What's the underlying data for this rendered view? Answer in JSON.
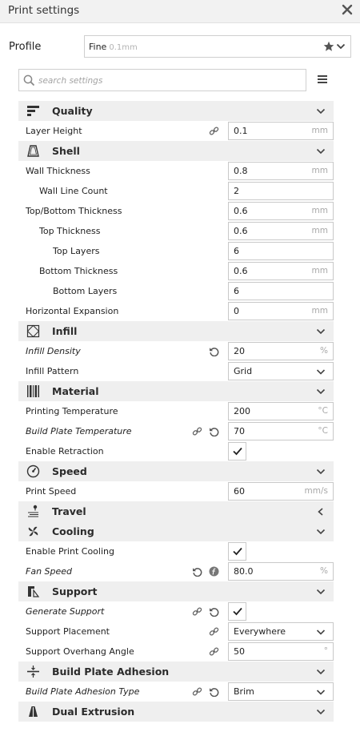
{
  "window": {
    "title": "Print settings"
  },
  "profile": {
    "label": "Profile",
    "name": "Fine",
    "detail": "0.1mm"
  },
  "search": {
    "placeholder": "search settings"
  },
  "colors": {
    "category_bg": "#efefef",
    "field_border": "#c9c9c9",
    "unit_text": "#a8a8a8"
  },
  "rows": [
    {
      "type": "cat",
      "label": "Quality",
      "icon": "quality-icon",
      "expanded": true
    },
    {
      "type": "setting",
      "label": "Layer Height",
      "indent": 0,
      "value": "0.1",
      "unit": "mm",
      "indicators": [
        "link"
      ]
    },
    {
      "type": "cat",
      "label": "Shell",
      "icon": "shell-icon",
      "expanded": true
    },
    {
      "type": "setting",
      "label": "Wall Thickness",
      "indent": 0,
      "value": "0.8",
      "unit": "mm"
    },
    {
      "type": "setting",
      "label": "Wall Line Count",
      "indent": 1,
      "value": "2",
      "unit": ""
    },
    {
      "type": "setting",
      "label": "Top/Bottom Thickness",
      "indent": 0,
      "value": "0.6",
      "unit": "mm"
    },
    {
      "type": "setting",
      "label": "Top Thickness",
      "indent": 1,
      "value": "0.6",
      "unit": "mm"
    },
    {
      "type": "setting",
      "label": "Top Layers",
      "indent": 2,
      "value": "6",
      "unit": ""
    },
    {
      "type": "setting",
      "label": "Bottom Thickness",
      "indent": 1,
      "value": "0.6",
      "unit": "mm"
    },
    {
      "type": "setting",
      "label": "Bottom Layers",
      "indent": 2,
      "value": "6",
      "unit": ""
    },
    {
      "type": "setting",
      "label": "Horizontal Expansion",
      "indent": 0,
      "value": "0",
      "unit": "mm"
    },
    {
      "type": "cat",
      "label": "Infill",
      "icon": "infill-icon",
      "expanded": true
    },
    {
      "type": "setting",
      "label": "Infill Density",
      "indent": 0,
      "italic": true,
      "value": "20",
      "unit": "%",
      "indicators": [
        "reset"
      ]
    },
    {
      "type": "select",
      "label": "Infill Pattern",
      "indent": 0,
      "value": "Grid"
    },
    {
      "type": "cat",
      "label": "Material",
      "icon": "material-icon",
      "expanded": true
    },
    {
      "type": "setting",
      "label": "Printing Temperature",
      "indent": 0,
      "value": "200",
      "unit": "°C"
    },
    {
      "type": "setting",
      "label": "Build Plate Temperature",
      "indent": 0,
      "italic": true,
      "value": "70",
      "unit": "°C",
      "indicators": [
        "link",
        "reset"
      ]
    },
    {
      "type": "check",
      "label": "Enable Retraction",
      "indent": 0,
      "checked": true
    },
    {
      "type": "cat",
      "label": "Speed",
      "icon": "speed-icon",
      "expanded": true
    },
    {
      "type": "setting",
      "label": "Print Speed",
      "indent": 0,
      "value": "60",
      "unit": "mm/s"
    },
    {
      "type": "cat",
      "label": "Travel",
      "icon": "travel-icon",
      "expanded": false
    },
    {
      "type": "cat",
      "label": "Cooling",
      "icon": "cooling-icon",
      "expanded": true
    },
    {
      "type": "check",
      "label": "Enable Print Cooling",
      "indent": 0,
      "checked": true
    },
    {
      "type": "setting",
      "label": "Fan Speed",
      "indent": 0,
      "italic": true,
      "value": "80.0",
      "unit": "%",
      "indicators": [
        "reset",
        "function"
      ]
    },
    {
      "type": "cat",
      "label": "Support",
      "icon": "support-icon",
      "expanded": true
    },
    {
      "type": "check",
      "label": "Generate Support",
      "indent": 0,
      "italic": true,
      "checked": true,
      "indicators": [
        "link",
        "reset"
      ]
    },
    {
      "type": "select",
      "label": "Support Placement",
      "indent": 0,
      "value": "Everywhere",
      "indicators": [
        "link"
      ]
    },
    {
      "type": "setting",
      "label": "Support Overhang Angle",
      "indent": 0,
      "value": "50",
      "unit": "°",
      "indicators": [
        "link"
      ]
    },
    {
      "type": "cat",
      "label": "Build Plate Adhesion",
      "icon": "adhesion-icon",
      "expanded": true
    },
    {
      "type": "select",
      "label": "Build Plate Adhesion Type",
      "indent": 0,
      "italic": true,
      "value": "Brim",
      "indicators": [
        "link",
        "reset"
      ]
    },
    {
      "type": "cat",
      "label": "Dual Extrusion",
      "icon": "dual-extrusion-icon",
      "expanded": true
    }
  ]
}
